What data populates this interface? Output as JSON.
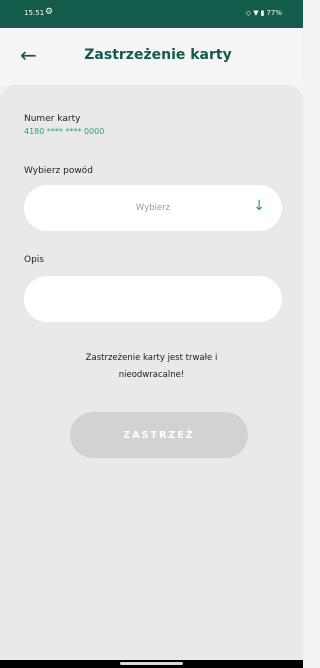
{
  "status_bar": {
    "time": "15:51",
    "settings_icon": "gear-icon",
    "connectivity_icons": [
      "wifi-icon",
      "signal-icon",
      "battery-icon"
    ],
    "battery_percent": "77%"
  },
  "header": {
    "title": "Zastrzeżenie karty",
    "back_icon": "arrow-left-icon"
  },
  "form": {
    "card_number_label": "Numer karty",
    "card_number_value": "4180 **** **** 0000",
    "reason_label": "Wybierz powód",
    "reason_placeholder": "Wybierz",
    "description_label": "Opis",
    "description_value": "",
    "warning_line1": "Zastrzeżenie karty jest trwałe i",
    "warning_line2": "nieodwracalne!",
    "submit_label": "ZASTRZEŻ"
  },
  "colors": {
    "brand": "#135b4a",
    "accent": "#2e9e70",
    "disabled": "#d2d2d2"
  }
}
